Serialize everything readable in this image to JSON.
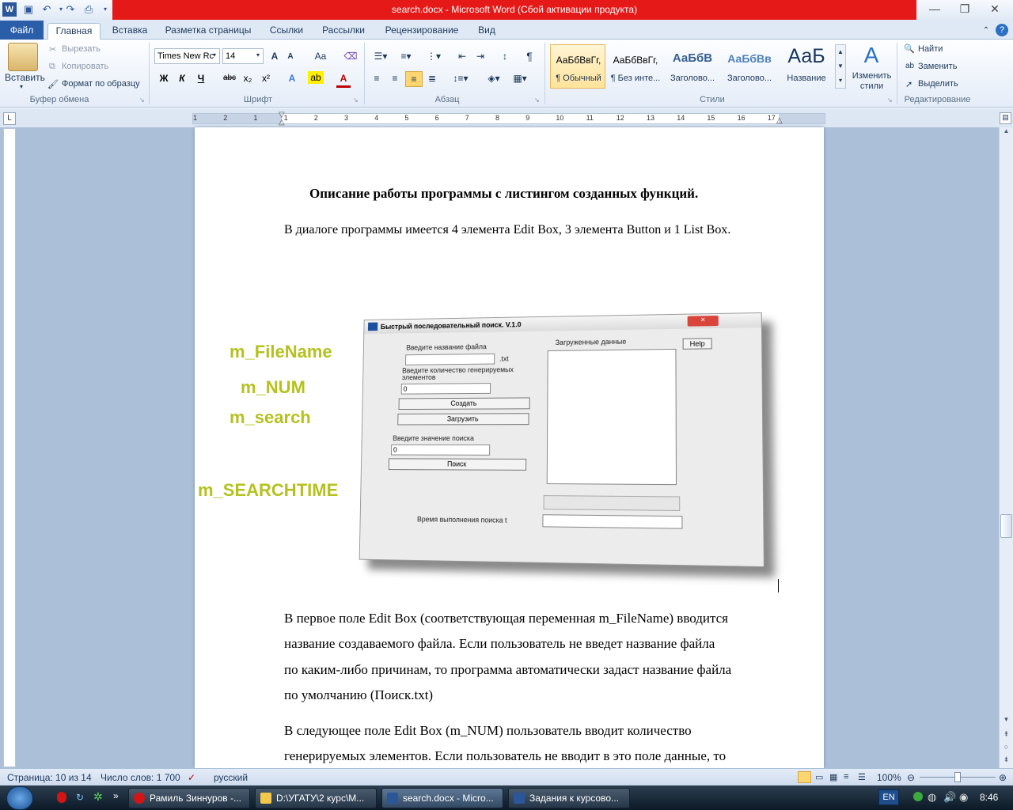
{
  "window": {
    "title": "search.docx - Microsoft Word (Сбой активации продукта)",
    "title_bar_color": "#e61919"
  },
  "tabs": [
    "Файл",
    "Главная",
    "Вставка",
    "Разметка страницы",
    "Ссылки",
    "Рассылки",
    "Рецензирование",
    "Вид"
  ],
  "ribbon": {
    "clipboard": {
      "paste": "Вставить",
      "cut": "Вырезать",
      "copy": "Копировать",
      "format_painter": "Формат по образцу",
      "group": "Буфер обмена"
    },
    "font": {
      "name": "Times New Rc",
      "size": "14",
      "group": "Шрифт",
      "bold": "Ж",
      "italic": "К",
      "underline": "Ч",
      "strike": "abc",
      "sub": "x₂",
      "sup": "x²",
      "grow": "A",
      "shrink": "A",
      "case": "Aa"
    },
    "paragraph": {
      "group": "Абзац",
      "pilcrow": "¶"
    },
    "styles": {
      "group": "Стили",
      "items": [
        {
          "preview": "АаБбВвГг,",
          "name": "¶ Обычный"
        },
        {
          "preview": "АаБбВвГг,",
          "name": "¶ Без инте..."
        },
        {
          "preview": "АаБбВ",
          "name": "Заголово..."
        },
        {
          "preview": "АаБбВв",
          "name": "Заголово..."
        },
        {
          "preview": "АаБ",
          "name": "Название"
        }
      ],
      "change": "Изменить стили"
    },
    "editing": {
      "group": "Редактирование",
      "find": "Найти",
      "replace": "Заменить",
      "select": "Выделить"
    }
  },
  "ruler": {
    "marks": [
      "1",
      "2",
      "1",
      "1",
      "2",
      "3",
      "4",
      "5",
      "6",
      "7",
      "8",
      "9",
      "10",
      "11",
      "12",
      "13",
      "14",
      "15",
      "16",
      "17"
    ]
  },
  "document": {
    "heading": "Описание работы программы с листингом созданных функций.",
    "intro": "В диалоге программы имеется 4 элемента Edit Box, 3 элемента Button  и  1 List Box.",
    "labels": [
      "m_FileName",
      "m_NUM",
      "m_search",
      "m_SEARCHTIME"
    ],
    "dialog": {
      "title": "Быстрый последовательный поиск. V.1.0",
      "close": "×",
      "help": "Help",
      "file_label": "Введите название файла",
      "ext": ".txt",
      "count_label": "Введите количество генерируемых элементов",
      "count_value": "0",
      "create_btn": "Создать",
      "load_btn": "Загрузить",
      "search_label": "Введите значение поиска",
      "search_value": "0",
      "search_btn": "Поиск",
      "loaded_label": "Загруженные данные",
      "time_label": "Время выполнения поиска t"
    },
    "para1": [
      "В первое поле Edit Box (соответствующая переменная m_FileName) вводится",
      "название создаваемого файла. Если пользователь не введет название файла",
      "по каким-либо причинам, то программа автоматически задаст название файла",
      "по умолчанию (Поиск.txt)"
    ],
    "para2": [
      "В следующее поле Edit Box (m_NUM)  пользователь вводит количество",
      "генерируемых элементов. Если пользователь не вводит в это поле данные, то"
    ]
  },
  "status": {
    "page": "Страница: 10 из 14",
    "words": "Число слов: 1 700",
    "lang": "русский",
    "zoom": "100%"
  },
  "taskbar": {
    "items": [
      "Рамиль Зиннуров -...",
      "D:\\УГАТУ\\2 курс\\М...",
      "search.docx - Micro...",
      "Задания к курсово..."
    ],
    "lang": "EN",
    "clock": "8:46"
  }
}
